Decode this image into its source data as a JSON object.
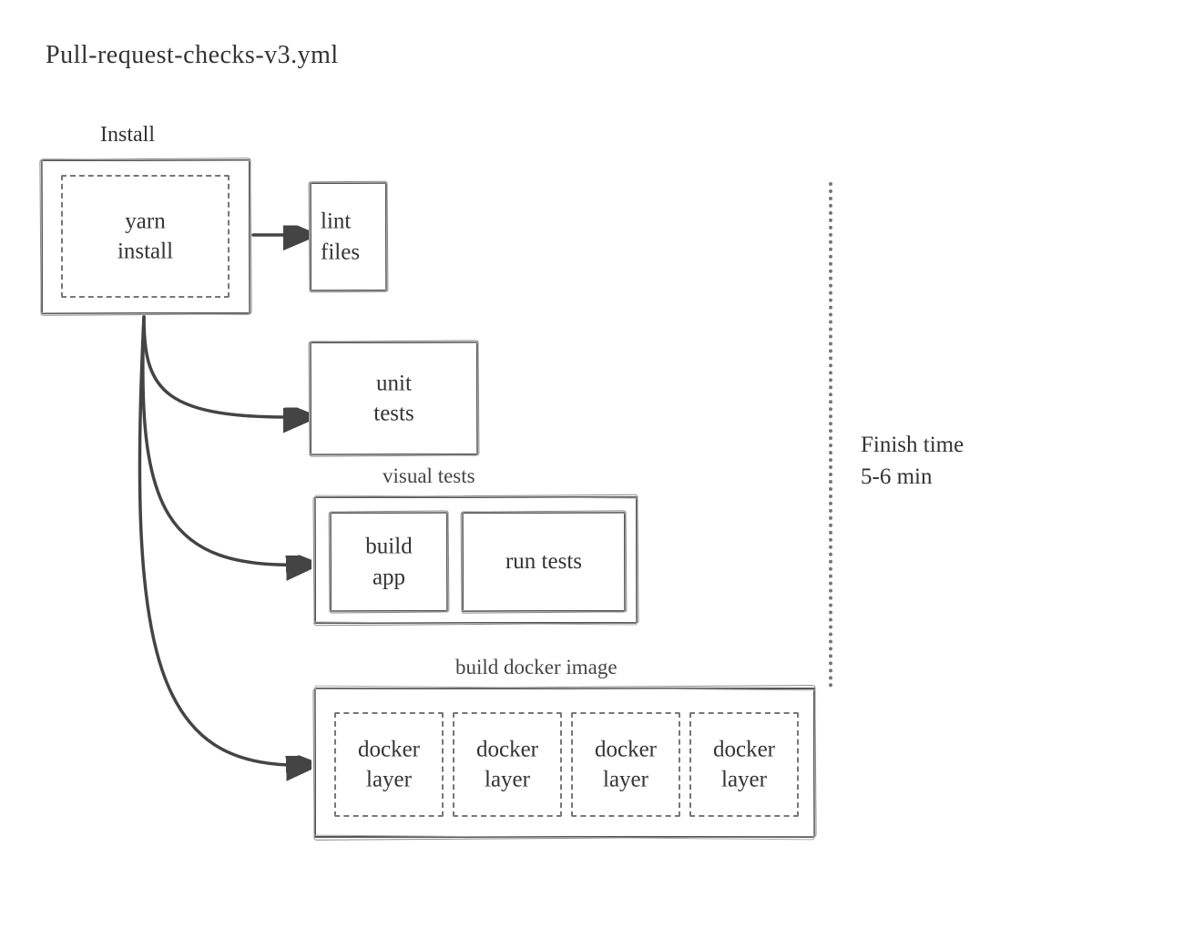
{
  "title": "Pull-request-checks-v3.yml",
  "install_label": "Install",
  "boxes": {
    "install": "yarn\ninstall",
    "lint": "lint\nfiles",
    "unit_tests": "unit\ntests",
    "visual_tests_label": "visual tests",
    "build_app": "build\napp",
    "run_tests": "run tests",
    "build_docker_label": "build docker image",
    "docker_layer_1": "docker\nlayer",
    "docker_layer_2": "docker\nlayer",
    "docker_layer_3": "docker\nlayer",
    "docker_layer_4": "docker\nlayer"
  },
  "finish": {
    "line1": "Finish time",
    "line2": "5-6 min"
  }
}
